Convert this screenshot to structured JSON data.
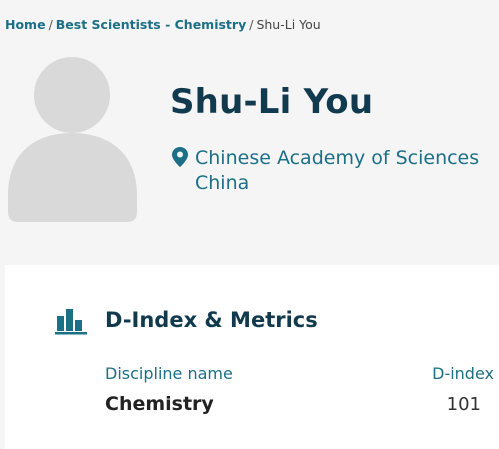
{
  "breadcrumb": {
    "items": [
      "Home",
      "Best Scientists - Chemistry"
    ],
    "current": "Shu-Li You"
  },
  "profile": {
    "name": "Shu-Li You",
    "institution": "Chinese Academy of Sciences",
    "country": "China",
    "avatar_icon": "user-silhouette-icon",
    "location_icon": "map-pin-icon"
  },
  "metrics": {
    "title": "D-Index & Metrics",
    "icon": "bar-chart-icon",
    "columns": {
      "discipline": "Discipline name",
      "dindex": "D-index"
    },
    "rows": [
      {
        "discipline": "Chemistry",
        "dindex": "101"
      }
    ]
  },
  "colors": {
    "link": "#1b6f86",
    "heading": "#123a4f",
    "avatar": "#d9d9d9",
    "background": "#f5f5f5"
  }
}
